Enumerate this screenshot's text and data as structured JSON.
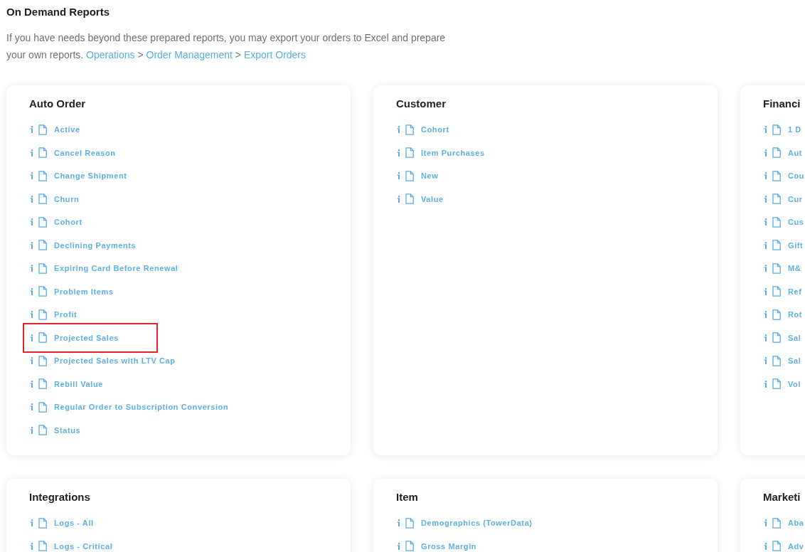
{
  "page": {
    "title": "On Demand Reports",
    "intro": "If you have needs beyond these prepared reports, you may export your orders to Excel and prepare your own reports.",
    "path": [
      {
        "kind": "link",
        "text": "Operations"
      },
      {
        "kind": "separator",
        "text": ">"
      },
      {
        "kind": "link",
        "text": "Order Management"
      },
      {
        "kind": "separator",
        "text": ">"
      },
      {
        "kind": "link",
        "text": "Export Orders"
      }
    ]
  },
  "categories": [
    {
      "title": "Auto Order",
      "reports": [
        {
          "label": "Active",
          "highlighted": false
        },
        {
          "label": "Cancel Reason",
          "highlighted": false
        },
        {
          "label": "Change Shipment",
          "highlighted": false
        },
        {
          "label": "Churn",
          "highlighted": false
        },
        {
          "label": "Cohort",
          "highlighted": false
        },
        {
          "label": "Declining Payments",
          "highlighted": false
        },
        {
          "label": "Expiring Card Before Renewal",
          "highlighted": false
        },
        {
          "label": "Problem Items",
          "highlighted": false
        },
        {
          "label": "Profit",
          "highlighted": false
        },
        {
          "label": "Projected Sales",
          "highlighted": true
        },
        {
          "label": "Projected Sales with LTV Cap",
          "highlighted": false
        },
        {
          "label": "Rebill Value",
          "highlighted": false
        },
        {
          "label": "Regular Order to Subscription Conversion",
          "highlighted": false
        },
        {
          "label": "Status",
          "highlighted": false
        }
      ]
    },
    {
      "title": "Customer",
      "reports": [
        {
          "label": "Cohort",
          "highlighted": false
        },
        {
          "label": "Item Purchases",
          "highlighted": false
        },
        {
          "label": "New",
          "highlighted": false
        },
        {
          "label": "Value",
          "highlighted": false
        }
      ]
    },
    {
      "title": "Financi",
      "reports": [
        {
          "label": "1 D",
          "highlighted": false
        },
        {
          "label": "Aut",
          "highlighted": false
        },
        {
          "label": "Cou",
          "highlighted": false
        },
        {
          "label": "Cur",
          "highlighted": false
        },
        {
          "label": "Cus",
          "highlighted": false
        },
        {
          "label": "Gift",
          "highlighted": false
        },
        {
          "label": "M&",
          "highlighted": false
        },
        {
          "label": "Ref",
          "highlighted": false
        },
        {
          "label": "Rot",
          "highlighted": false
        },
        {
          "label": "Sal",
          "highlighted": false
        },
        {
          "label": "Sal",
          "highlighted": false
        },
        {
          "label": "Vol",
          "highlighted": false
        }
      ]
    },
    {
      "title": "Integrations",
      "reports": [
        {
          "label": "Logs - All",
          "highlighted": false
        },
        {
          "label": "Logs - Critical",
          "highlighted": false
        }
      ]
    },
    {
      "title": "Item",
      "reports": [
        {
          "label": "Demographics (TowerData)",
          "highlighted": false
        },
        {
          "label": "Gross Margin",
          "highlighted": false
        }
      ]
    },
    {
      "title": "Marketi",
      "reports": [
        {
          "label": "Aba",
          "highlighted": false
        },
        {
          "label": "Adv",
          "highlighted": false
        }
      ]
    }
  ]
}
